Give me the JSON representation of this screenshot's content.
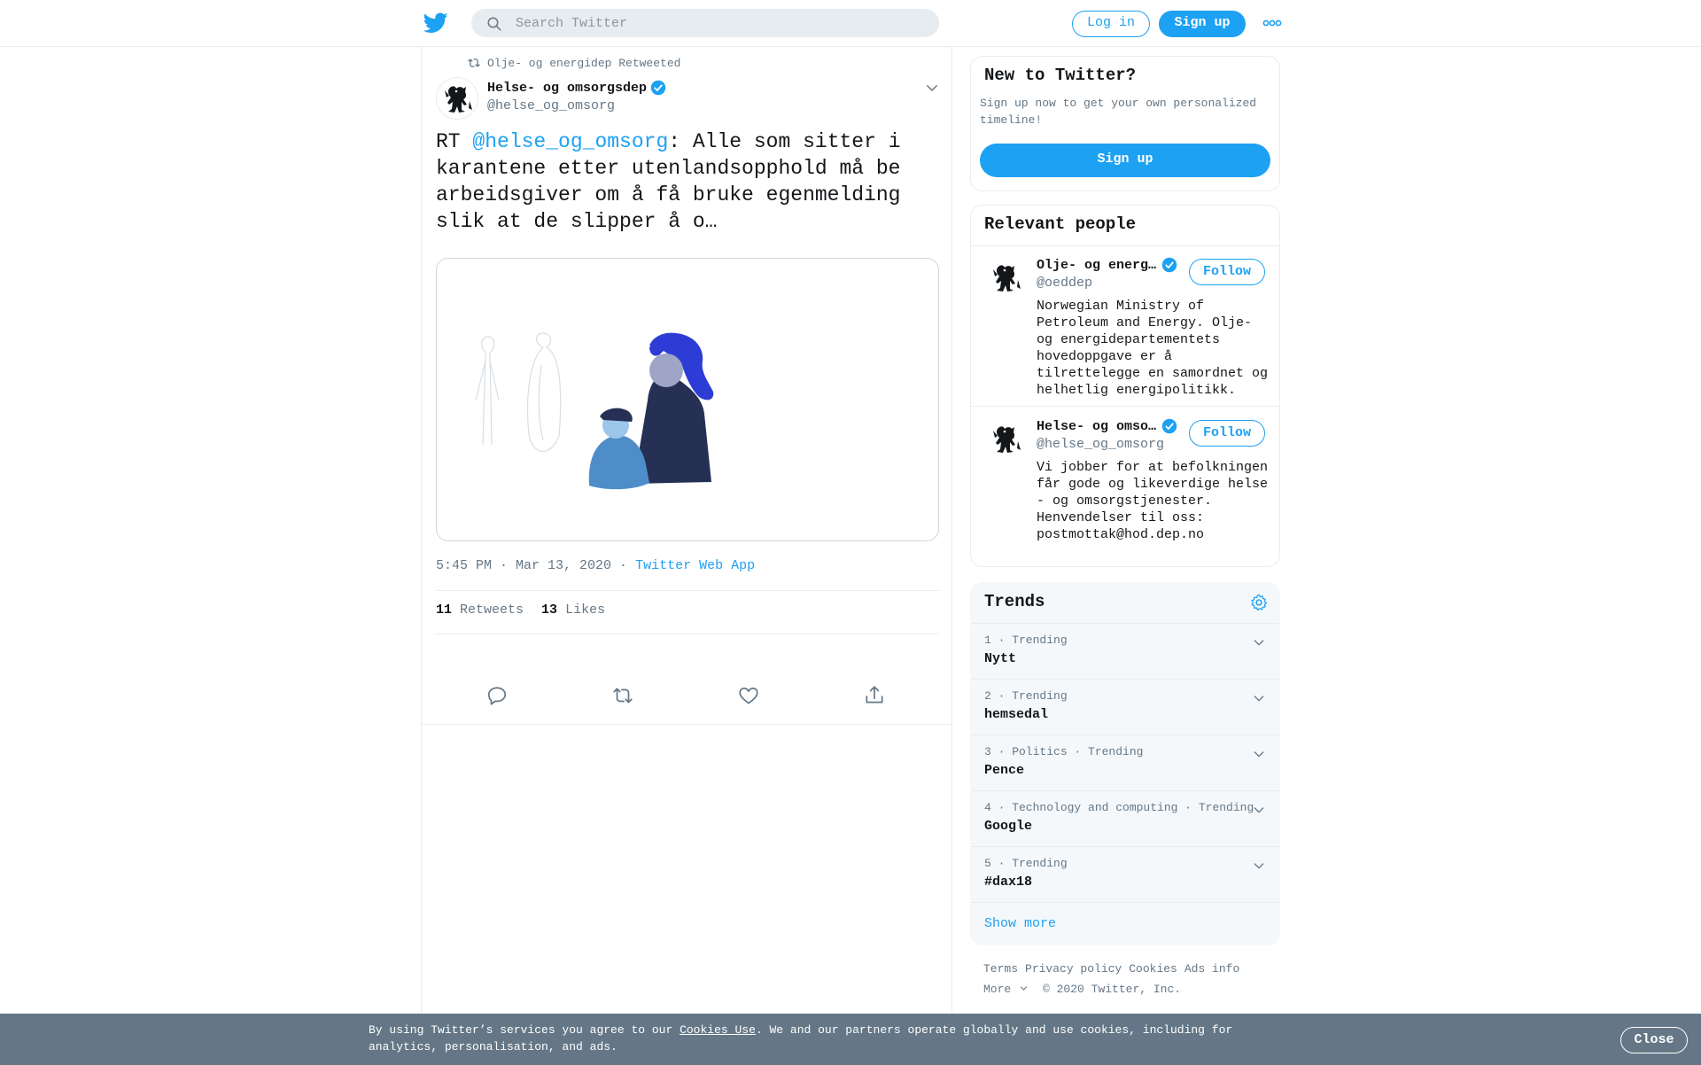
{
  "header": {
    "logo_icon": "twitter-bird-icon",
    "search_placeholder": "Search Twitter",
    "login_label": "Log in",
    "signup_label": "Sign up",
    "more_icon": "more-dots-icon"
  },
  "tweet": {
    "retweeted_by": "Olje- og energidep Retweeted",
    "author_name": "Helse- og omsorgsdep",
    "author_handle": "@helse_og_omsorg",
    "text_prefix": "RT ",
    "text_mention": "@helse_og_omsorg",
    "text_body": ": Alle som sitter i karantene etter utenlandsopphold må be arbeidsgiver om å få bruke egenmelding slik at de slipper å o…",
    "timestamp": "5:45 PM · Mar 13, 2020",
    "separator": " · ",
    "source_app": "Twitter Web App",
    "retweets_count": "11",
    "retweets_label": "Retweets",
    "likes_count": "13",
    "likes_label": "Likes"
  },
  "new_to_twitter": {
    "title": "New to Twitter?",
    "subtitle": "Sign up now to get your own personalized timeline!",
    "button": "Sign up"
  },
  "relevant_people": {
    "title": "Relevant people",
    "people": [
      {
        "name": "Olje- og energ…",
        "handle": "@oeddep",
        "follow": "Follow",
        "bio": "Norwegian Ministry of Petroleum and Energy. Olje- og energidepartementets hovedoppgave er å tilrettelegge en samordnet og helhetlig energipolitikk."
      },
      {
        "name": "Helse- og omso…",
        "handle": "@helse_og_omsorg",
        "follow": "Follow",
        "bio": "Vi jobber for at befolkningen får gode og likeverdige helse - og omsorgstjenester. Henvendelser til oss: postmottak@hod.dep.no"
      }
    ]
  },
  "trends": {
    "title": "Trends",
    "items": [
      {
        "meta": "1 · Trending",
        "name": "Nytt"
      },
      {
        "meta": "2 · Trending",
        "name": "hemsedal"
      },
      {
        "meta": "3 · Politics · Trending",
        "name": "Pence"
      },
      {
        "meta": "4 · Technology and computing · Trending",
        "name": "Google"
      },
      {
        "meta": "5 · Trending",
        "name": "#dax18"
      }
    ],
    "show_more": "Show more"
  },
  "footer": {
    "links": [
      "Terms",
      "Privacy policy",
      "Cookies",
      "Ads info"
    ],
    "more": "More",
    "copyright": "© 2020 Twitter, Inc."
  },
  "cookie_bar": {
    "text_before": "By using Twitter’s services you agree to our ",
    "link": "Cookies Use",
    "text_after": ". We and our partners operate globally and use cookies, including for analytics, personalisation, and ads.",
    "close": "Close"
  },
  "colors": {
    "accent": "#1da1f2",
    "text": "#14171a",
    "secondary": "#657786",
    "border": "#e6ecf0",
    "cookie_bg": "#657786"
  }
}
